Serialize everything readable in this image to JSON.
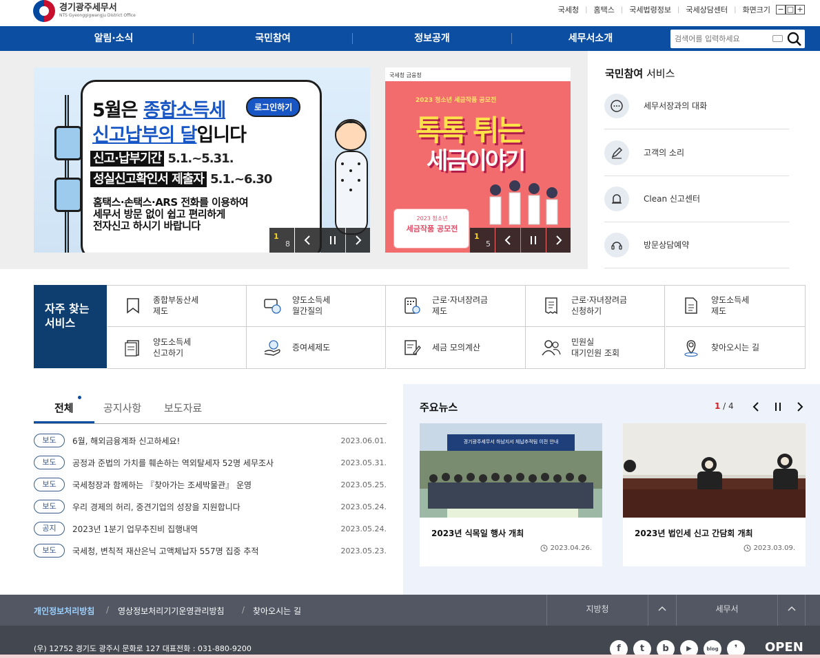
{
  "header": {
    "logo_name": "경기광주세무서",
    "logo_sub": "NTS Gyeonggigwangju District Office",
    "util_links": [
      "국세청",
      "홈택스",
      "국세법령정보",
      "국세상담센터",
      "화면크기"
    ],
    "zoom_buttons": [
      "−",
      "□",
      "+"
    ]
  },
  "gnb": {
    "items": [
      "알림·소식",
      "국민참여",
      "정보공개",
      "세무서소개"
    ],
    "search_placeholder": "검색어를 입력하세요"
  },
  "banner1": {
    "line1_pre": "5월은 ",
    "line1_hl": "종합소득세",
    "badge": "로그인하기",
    "line2_hl": "신고납부의 달",
    "line2_post": "입니다",
    "row1_key": "신고·납부기간",
    "row1_val": " 5.1.~5.31.",
    "row2_key": "성실신고확인서 제출자",
    "row2_val": " 5.1.~6.30",
    "note": "홈택스·손택스·ARS 전화를 이용하여\n세무서 방문 없이 쉽고 편리하게\n전자신고 하시기 바랍니다",
    "page_current": "1",
    "page_total": "8"
  },
  "banner2": {
    "top": "국세청   금융청",
    "subtitle": "2023 청소년 세금작품 공모전",
    "big1": "톡톡 튀는",
    "big2": "세금이야기",
    "card_a": "2023 청소년",
    "card_b": "세금작품 공모전",
    "page_current": "1",
    "page_total": "5"
  },
  "service": {
    "title_bold": "국민참여",
    "title_rest": " 서비스",
    "items": [
      {
        "label": "세무서장과의 대화",
        "icon": "chat-icon"
      },
      {
        "label": "고객의 소리",
        "icon": "pencil-icon"
      },
      {
        "label": "Clean 신고센터",
        "icon": "bell-icon"
      },
      {
        "label": "방문상담예약",
        "icon": "headset-icon"
      }
    ]
  },
  "frequent": {
    "title": "자주 찾는\n서비스",
    "items": [
      {
        "label": "종합부동산세\n제도",
        "icon": "bookmark-icon"
      },
      {
        "label": "양도소득세\n월간질의",
        "icon": "qa-icon"
      },
      {
        "label": "근로·자녀장려금\n제도",
        "icon": "calculator-icon"
      },
      {
        "label": "근로·자녀장려금\n신청하기",
        "icon": "receipt-icon"
      },
      {
        "label": "양도소득세\n제도",
        "icon": "document-icon"
      },
      {
        "label": "양도소득세\n신고하기",
        "icon": "form-icon"
      },
      {
        "label": "증여세제도",
        "icon": "coin-hand-icon"
      },
      {
        "label": "세금 모의계산",
        "icon": "edit-doc-icon"
      },
      {
        "label": "민원실\n대기인원 조회",
        "icon": "people-icon"
      },
      {
        "label": "찾아오시는 길",
        "icon": "location-icon"
      }
    ]
  },
  "news": {
    "tabs": [
      "전체",
      "공지사항",
      "보도자료"
    ],
    "items": [
      {
        "tag": "보도",
        "title": "6월, 해외금융계좌 신고하세요!",
        "date": "2023.06.01."
      },
      {
        "tag": "보도",
        "title": "공정과 준법의 가치를 훼손하는 역외탈세자 52명 세무조사",
        "date": "2023.05.31."
      },
      {
        "tag": "보도",
        "title": "국세청장과 함께하는 『찾아가는 조세박물관』 운영",
        "date": "2023.05.25."
      },
      {
        "tag": "보도",
        "title": "우리 경제의 허리, 중견기업의 성장을 지원합니다",
        "date": "2023.05.24."
      },
      {
        "tag": "공지",
        "title": "2023년 1분기 업무추진비 집행내역",
        "date": "2023.05.24."
      },
      {
        "tag": "보도",
        "title": "국세청, 변칙적 재산은닉 고액체납자 557명 집중 추적",
        "date": "2023.05.23."
      }
    ]
  },
  "main_news": {
    "title": "주요뉴스",
    "page_current": "1",
    "page_sep": " / ",
    "page_total": "4",
    "cards": [
      {
        "title": "2023년 식목일 행사 개최",
        "date": "2023.04.26.",
        "banner": "경기광주세무서 하남지서 체납추적팀 이전 안내"
      },
      {
        "title": "2023년 법인세 신고 간담회 개최",
        "date": "2023.03.09."
      }
    ]
  },
  "footer": {
    "links": [
      "개인정보처리방침",
      "영상정보처리기기운영관리방침",
      "찾아오시는 길"
    ],
    "select1": "지방청",
    "select2": "세무서",
    "address": "(우) 12752 경기도 광주시 문화로 127 대표전화 : 031-880-9200",
    "sns": [
      "f",
      "t",
      "b",
      "▶",
      "blog",
      "❜"
    ],
    "open": "OPEN"
  },
  "colors": {
    "gnb": "#0b4ea2",
    "freq_title": "#0e3e6f",
    "footer": "#525763",
    "accent_red": "#d21f26"
  }
}
